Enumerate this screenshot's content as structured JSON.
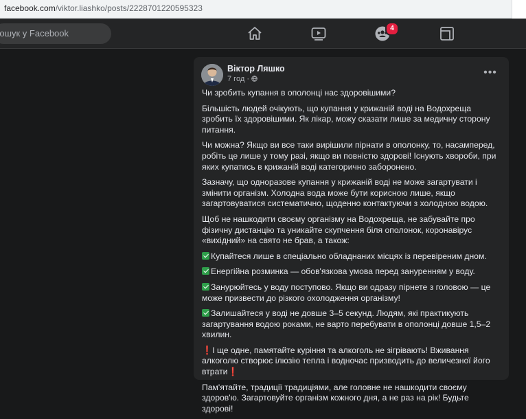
{
  "browser": {
    "url_domain": "facebook.com",
    "url_path": "/viktor.liashko/posts/2228701220595323"
  },
  "topnav": {
    "search_placeholder": "Пошук у Facebook",
    "groups_badge": "4"
  },
  "post": {
    "author": "Віктор Ляшко",
    "time": "7 год",
    "separator": "·",
    "menu_glyph": "•••",
    "p1": "Чи зробить купання в ополонці нас здоровішими?",
    "p2": "Більшість людей очікують, що  купання у крижаній воді на Водохреща зробить їх здоровішими.  Як лікар, можу сказати лише  за медичну сторону питання.",
    "p3": "Чи можна? Якщо ви все таки вирішили пірнати в ополонку, то, насамперед, робіть це лише у тому разі, якщо ви повністю здорові! Існують хвороби, при яких купатись в крижаній воді категорично заборонено.",
    "p4": "Зазначу, що одноразове купання у крижаній воді не може загартувати і змінити організм. Холодна вода може бути корисною лише, якщо загартовуватися систематично, щоденно контактуючи з холодною водою.",
    "p5": "Щоб не нашкодити своєму організму на Водохреща, не забувайте про фізичну дистанцію та уникайте скупчення біля ополонок, коронавірус «вихідний» на свято не брав, а також:",
    "tips": [
      "Купайтеся лише в спеціально обладнаних місцях із перевіреним дном.",
      "Енергійна розминка — обов'язкова умова перед зануренням у воду.",
      "Занурюйтесь у воду поступово. Якщо ви одразу пірнете з головою — це може призвести до різкого охолодження організму!",
      "Залишайтеся у воді не довше 3–5 секунд. Людям, які практикують загартування водою роками, не варто перебувати в ополонці довше 1,5–2 хвилин."
    ],
    "p6": "І ще одне, памятайте куріння та алкоголь не зігрівають! Вживання алкоголю створює ілюзію тепла і водночас призводить до величезної його втрати",
    "p7": "Пам'ятайте, традиції традиціями, але головне не нашкодити своєму здоров'ю. Загартовуйте організм кожного дня, а  не раз на рік! Будьте здорові!",
    "exclamation": "❗"
  },
  "colors": {
    "page_bg": "#18191a",
    "card_bg": "#242526",
    "text": "#e4e6eb",
    "secondary_text": "#b0b3b8",
    "check_green": "#2e9e4a",
    "badge_red": "#e41e3f"
  }
}
